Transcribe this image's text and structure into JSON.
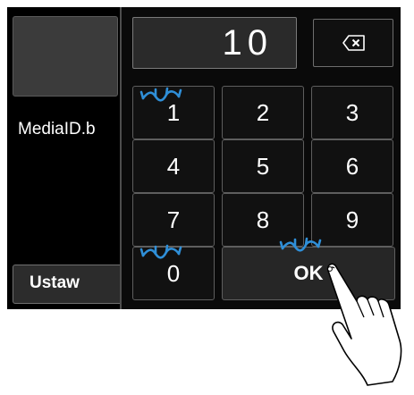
{
  "background": {
    "media_label": "MediaID.b",
    "settings_label": "Ustaw"
  },
  "keypad": {
    "display_value": "10",
    "backspace_icon": "backspace-icon",
    "keys": [
      "1",
      "2",
      "3",
      "4",
      "5",
      "6",
      "7",
      "8",
      "9",
      "0"
    ],
    "ok_label": "OK"
  },
  "annotations": {
    "tap_mark_color": "#2f8fd8",
    "tapped_keys": [
      "1",
      "0",
      "OK"
    ]
  }
}
